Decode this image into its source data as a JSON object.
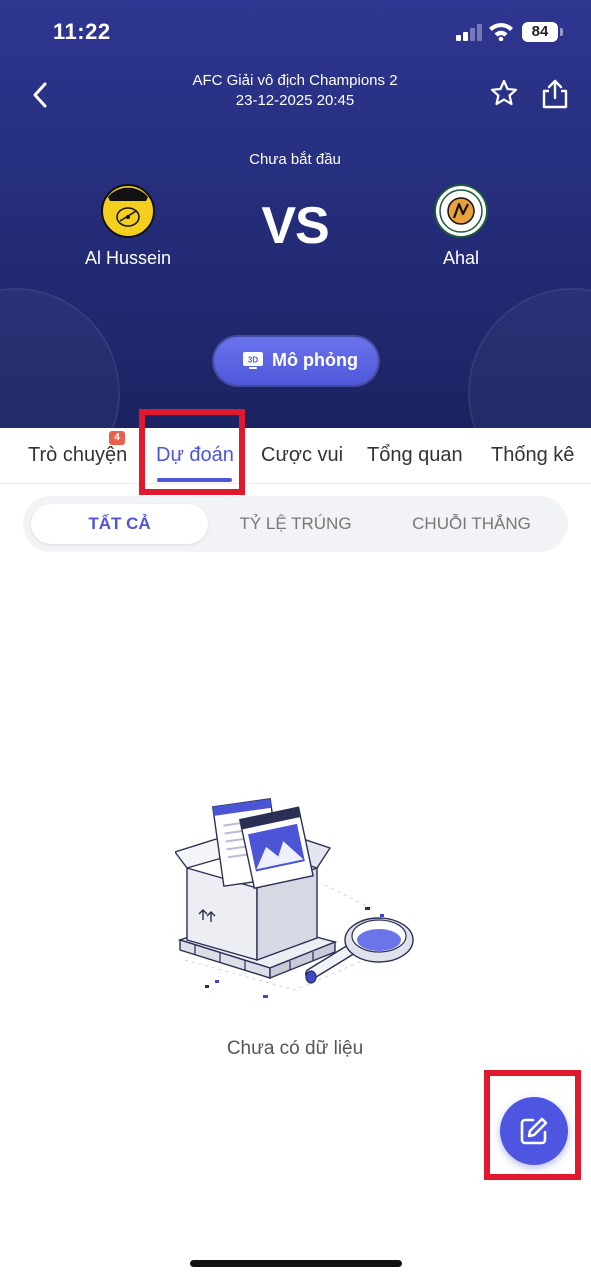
{
  "status_bar": {
    "time": "11:22",
    "battery": "84"
  },
  "match": {
    "league": "AFC Giải vô địch Champions 2",
    "datetime": "23-12-2025 20:45",
    "status": "Chưa bắt đầu",
    "vs": "VS",
    "home_team": "Al Hussein",
    "away_team": "Ahal",
    "simulate_label": "Mô phỏng",
    "simulate_badge": "3D"
  },
  "tabs": [
    {
      "label": "Trò chuyện",
      "badge": "4"
    },
    {
      "label": "Dự đoán",
      "active": true
    },
    {
      "label": "Cược vui"
    },
    {
      "label": "Tổng quan"
    },
    {
      "label": "Thống kê"
    }
  ],
  "filters": [
    {
      "label": "TẤT CẢ",
      "active": true
    },
    {
      "label": "TỶ LỆ TRÚNG"
    },
    {
      "label": "CHUỖI THẮNG"
    }
  ],
  "empty_state": {
    "message": "Chưa có dữ liệu",
    "icon": "empty-box-illustration"
  },
  "fab": {
    "icon": "edit-icon"
  },
  "colors": {
    "header_bg": "#2a3286",
    "accent": "#4e55d8",
    "badge": "#e9614c",
    "highlight": "#e0192f"
  }
}
